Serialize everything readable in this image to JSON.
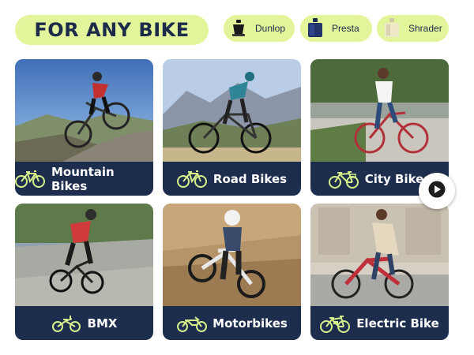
{
  "header": {
    "title": "FOR ANY BIKE"
  },
  "valves": [
    {
      "label": "Dunlop",
      "icon": "dunlop-valve-icon"
    },
    {
      "label": "Presta",
      "icon": "presta-valve-icon"
    },
    {
      "label": "Shrader",
      "icon": "shrader-valve-icon"
    }
  ],
  "cards": [
    {
      "label": "Mountain Bikes",
      "icon": "bicycle-icon",
      "photo": "mountain-biker-photo"
    },
    {
      "label": "Road Bikes",
      "icon": "bicycle-icon",
      "photo": "road-cyclist-photo"
    },
    {
      "label": "City Bikes",
      "icon": "city-bicycle-icon",
      "photo": "city-cyclist-photo"
    },
    {
      "label": "BMX",
      "icon": "bmx-bicycle-icon",
      "photo": "bmx-rider-photo"
    },
    {
      "label": "Motorbikes",
      "icon": "motorbike-icon",
      "photo": "dirt-bike-rider-photo"
    },
    {
      "label": "Electric Bike",
      "icon": "electric-bicycle-icon",
      "photo": "e-bike-rider-photo"
    }
  ],
  "colors": {
    "accent": "#e3f59a",
    "navy": "#1d2d4e",
    "icon_green": "#d7f08a"
  },
  "next_button": {
    "icon": "play-arrow-icon"
  }
}
